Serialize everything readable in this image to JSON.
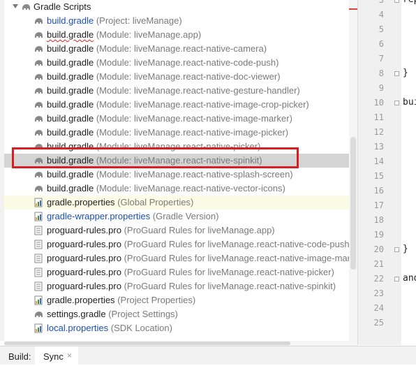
{
  "project_tree": {
    "root": {
      "label": "Gradle Scripts",
      "icon": "gradle-elephant-icon"
    },
    "rows": [
      {
        "name": "build.gradle",
        "desc": "(Project: liveManage)",
        "icon": "gradle-elephant-icon",
        "color": "blue"
      },
      {
        "name": "build.gradle",
        "desc": "(Module: liveManage.app)",
        "icon": "gradle-elephant-icon",
        "squiggle": true
      },
      {
        "name": "build.gradle",
        "desc": "(Module: liveManage.react-native-camera)",
        "icon": "gradle-elephant-icon"
      },
      {
        "name": "build.gradle",
        "desc": "(Module: liveManage.react-native-code-push)",
        "icon": "gradle-elephant-icon"
      },
      {
        "name": "build.gradle",
        "desc": "(Module: liveManage.react-native-doc-viewer)",
        "icon": "gradle-elephant-icon"
      },
      {
        "name": "build.gradle",
        "desc": "(Module: liveManage.react-native-gesture-handler)",
        "icon": "gradle-elephant-icon"
      },
      {
        "name": "build.gradle",
        "desc": "(Module: liveManage.react-native-image-crop-picker)",
        "icon": "gradle-elephant-icon"
      },
      {
        "name": "build.gradle",
        "desc": "(Module: liveManage.react-native-image-marker)",
        "icon": "gradle-elephant-icon"
      },
      {
        "name": "build.gradle",
        "desc": "(Module: liveManage.react-native-image-picker)",
        "icon": "gradle-elephant-icon"
      },
      {
        "name": "build.gradle",
        "desc": "(Module: liveManage.react-native-picker)",
        "icon": "gradle-elephant-icon"
      },
      {
        "name": "build.gradle",
        "desc": "(Module: liveManage.react-native-spinkit)",
        "icon": "gradle-elephant-icon",
        "highlighted": true
      },
      {
        "name": "build.gradle",
        "desc": "(Module: liveManage.react-native-splash-screen)",
        "icon": "gradle-elephant-icon"
      },
      {
        "name": "build.gradle",
        "desc": "(Module: liveManage.react-native-vector-icons)",
        "icon": "gradle-elephant-icon"
      },
      {
        "name": "gradle.properties",
        "desc": "(Global Properties)",
        "icon": "properties-file-icon",
        "soft": true
      },
      {
        "name": "gradle-wrapper.properties",
        "desc": "(Gradle Version)",
        "icon": "properties-file-icon",
        "color": "blue"
      },
      {
        "name": "proguard-rules.pro",
        "desc": "(ProGuard Rules for liveManage.app)",
        "icon": "text-file-icon"
      },
      {
        "name": "proguard-rules.pro",
        "desc": "(ProGuard Rules for liveManage.react-native-code-push)",
        "icon": "text-file-icon"
      },
      {
        "name": "proguard-rules.pro",
        "desc": "(ProGuard Rules for liveManage.react-native-image-mark",
        "icon": "text-file-icon"
      },
      {
        "name": "proguard-rules.pro",
        "desc": "(ProGuard Rules for liveManage.react-native-picker)",
        "icon": "text-file-icon"
      },
      {
        "name": "proguard-rules.pro",
        "desc": "(ProGuard Rules for liveManage.react-native-spinkit)",
        "icon": "text-file-icon"
      },
      {
        "name": "gradle.properties",
        "desc": "(Project Properties)",
        "icon": "properties-file-icon"
      },
      {
        "name": "settings.gradle",
        "desc": "(Project Settings)",
        "icon": "gradle-elephant-icon"
      },
      {
        "name": "local.properties",
        "desc": "(SDK Location)",
        "icon": "properties-file-icon",
        "color": "blue"
      }
    ]
  },
  "editor": {
    "lines": [
      {
        "n": "3",
        "code": "rep",
        "fold": true
      },
      {
        "n": "4",
        "code": ""
      },
      {
        "n": "5",
        "code": ""
      },
      {
        "n": "6",
        "code": ""
      },
      {
        "n": "7",
        "code": ""
      },
      {
        "n": "8",
        "code": "}",
        "fold": true
      },
      {
        "n": "9",
        "code": ""
      },
      {
        "n": "10",
        "code": "bui",
        "fold": true
      },
      {
        "n": "11",
        "code": ""
      },
      {
        "n": "12",
        "code": ""
      },
      {
        "n": "13",
        "code": ""
      },
      {
        "n": "14",
        "code": ""
      },
      {
        "n": "15",
        "code": ""
      },
      {
        "n": "16",
        "code": ""
      },
      {
        "n": "17",
        "code": ""
      },
      {
        "n": "18",
        "code": ""
      },
      {
        "n": "19",
        "code": ""
      },
      {
        "n": "20",
        "code": "}",
        "fold": true
      },
      {
        "n": "21",
        "code": ""
      },
      {
        "n": "22",
        "code": "and",
        "fold": true
      },
      {
        "n": "23",
        "code": ""
      },
      {
        "n": "24",
        "code": ""
      },
      {
        "n": "25",
        "code": ""
      }
    ]
  },
  "bottom_bar": {
    "build_label": "Build:",
    "sync_tab_label": "Sync",
    "close_glyph": "×"
  },
  "colors": {
    "highlight_box": "#d81e1e",
    "file_blue": "#1a4fb5",
    "hover_row": "#d4d4d4"
  }
}
